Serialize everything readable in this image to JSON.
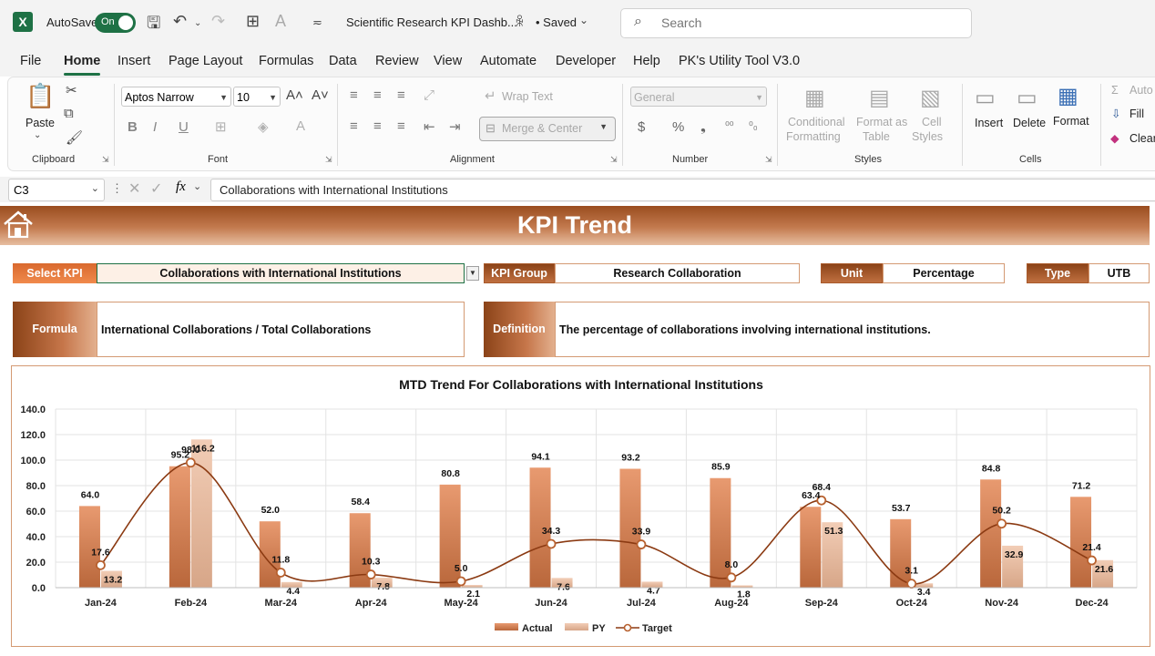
{
  "app": {
    "autosave_label": "AutoSave",
    "autosave_state": "On",
    "doc_title": "Scientific Research KPI Dashb...",
    "saved_status": "• Saved",
    "search_placeholder": "Search"
  },
  "menu": [
    "File",
    "Home",
    "Insert",
    "Page Layout",
    "Formulas",
    "Data",
    "Review",
    "View",
    "Automate",
    "Developer",
    "Help",
    "PK's Utility Tool V3.0"
  ],
  "ribbon": {
    "clipboard": {
      "label": "Clipboard",
      "paste": "Paste"
    },
    "font": {
      "label": "Font",
      "family": "Aptos Narrow",
      "size": "10",
      "bold": "B",
      "italic": "I",
      "underline": "U"
    },
    "alignment": {
      "label": "Alignment",
      "wrap": "Wrap Text",
      "merge": "Merge & Center"
    },
    "number": {
      "label": "Number",
      "format": "General",
      "currency": "$",
      "percent": "%"
    },
    "styles": {
      "label": "Styles",
      "conditional": "Conditional",
      "conditional2": "Formatting",
      "format_table": "Format as",
      "format_table2": "Table",
      "cell_styles": "Cell",
      "cell_styles2": "Styles"
    },
    "cells": {
      "label": "Cells",
      "insert": "Insert",
      "delete": "Delete",
      "format": "Format"
    },
    "editing": {
      "autosum": "Auto",
      "fill": "Fill",
      "clear": "Clear"
    }
  },
  "formula_bar": {
    "cell_ref": "C3",
    "fx": "fx",
    "content": "Collaborations with International Institutions"
  },
  "sheet": {
    "title": "KPI Trend",
    "select_kpi_label": "Select KPI",
    "select_kpi_value": "Collaborations with International Institutions",
    "kpi_group_label": "KPI Group",
    "kpi_group_value": "Research Collaboration",
    "unit_label": "Unit",
    "unit_value": "Percentage",
    "type_label": "Type",
    "type_value": "UTB",
    "formula_label": "Formula",
    "formula_value": "International Collaborations / Total Collaborations",
    "definition_label": "Definition",
    "definition_value": "The percentage of collaborations involving international institutions."
  },
  "colors": {
    "accent": "#1e7145",
    "header_dark": "#9a4d1f",
    "actual": "#e08a5c",
    "py": "#e8b89c",
    "target": "#8b3a12"
  },
  "chart_data": {
    "type": "bar",
    "title": "MTD Trend For Collaborations with International Institutions",
    "categories": [
      "Jan-24",
      "Feb-24",
      "Mar-24",
      "Apr-24",
      "May-24",
      "Jun-24",
      "Jul-24",
      "Aug-24",
      "Sep-24",
      "Oct-24",
      "Nov-24",
      "Dec-24"
    ],
    "series": [
      {
        "name": "Actual",
        "type": "bar",
        "values": [
          64.0,
          95.2,
          52.0,
          58.4,
          80.8,
          94.1,
          93.2,
          85.9,
          63.4,
          53.7,
          84.8,
          71.2
        ]
      },
      {
        "name": "PY",
        "type": "bar",
        "values": [
          13.2,
          116.2,
          4.4,
          7.8,
          2.1,
          7.6,
          4.7,
          1.8,
          51.3,
          3.4,
          32.9,
          21.6
        ]
      },
      {
        "name": "Target",
        "type": "line",
        "values": [
          17.6,
          98.0,
          11.8,
          10.3,
          5.0,
          34.3,
          33.9,
          8.0,
          68.4,
          3.1,
          50.2,
          21.4
        ]
      }
    ],
    "ylim": [
      0,
      140
    ],
    "yticks": [
      "0.0",
      "20.0",
      "40.0",
      "60.0",
      "80.0",
      "100.0",
      "120.0",
      "140.0"
    ],
    "grid": true,
    "legend": "bottom"
  }
}
